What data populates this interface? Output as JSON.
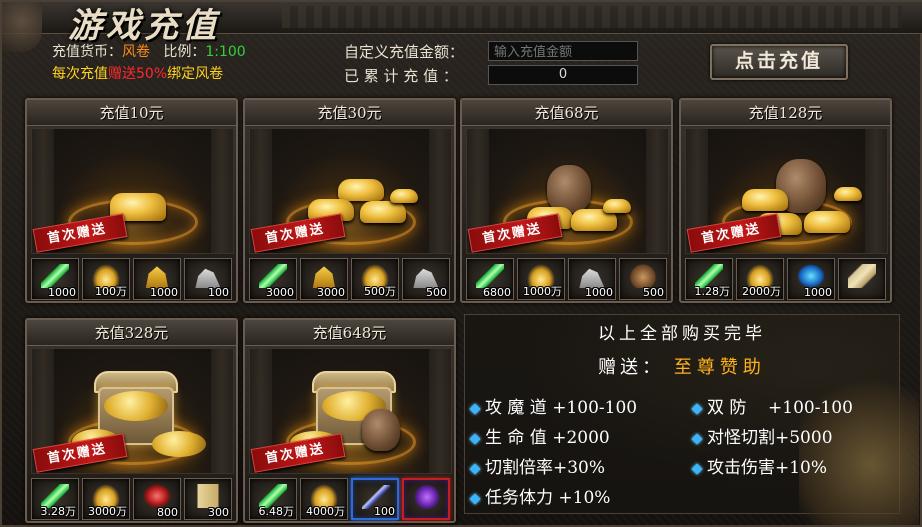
{
  "title": "游戏充值",
  "header": {
    "currency_label": "充值货币：",
    "currency_value": "风卷",
    "ratio_label": "比例：",
    "ratio_value": "1:100",
    "bonus_prefix": "每次充值",
    "bonus_highlight": "赠送50%",
    "bonus_suffix": "绑定风卷",
    "custom_amount_label": "自定义充值金额：",
    "custom_amount_placeholder": "输入充值金额",
    "custom_amount_value": "",
    "total_label": "已 累 计 充 值 ：",
    "total_value": "0",
    "charge_button": "点击充值"
  },
  "packages": [
    {
      "title": "充值10元",
      "ribbon": "首次赠送",
      "items": [
        {
          "icon": "scroll-icon",
          "count": "1000"
        },
        {
          "icon": "gold-ingot-icon",
          "count": "100万"
        },
        {
          "icon": "gold-bars-icon",
          "count": "1000"
        },
        {
          "icon": "silver-ore-icon",
          "count": "100"
        }
      ]
    },
    {
      "title": "充值30元",
      "ribbon": "首次赠送",
      "items": [
        {
          "icon": "scroll-icon",
          "count": "3000"
        },
        {
          "icon": "gold-bars-icon",
          "count": "3000"
        },
        {
          "icon": "gold-ingot-icon",
          "count": "500万"
        },
        {
          "icon": "silver-ore-icon",
          "count": "500"
        }
      ]
    },
    {
      "title": "充值68元",
      "ribbon": "首次赠送",
      "items": [
        {
          "icon": "scroll-icon",
          "count": "6800"
        },
        {
          "icon": "gold-ingot-icon",
          "count": "1000万"
        },
        {
          "icon": "silver-ore-icon",
          "count": "1000"
        },
        {
          "icon": "pouch-icon",
          "count": "500"
        }
      ]
    },
    {
      "title": "充值128元",
      "ribbon": "首次赠送",
      "items": [
        {
          "icon": "scroll-icon",
          "count": "1.28万"
        },
        {
          "icon": "gold-ingot-icon",
          "count": "2000万"
        },
        {
          "icon": "blue-gem-icon",
          "count": "1000"
        },
        {
          "icon": "parchment-icon",
          "count": ""
        }
      ]
    },
    {
      "title": "充值328元",
      "ribbon": "首次赠送",
      "items": [
        {
          "icon": "scroll-icon",
          "count": "3.28万"
        },
        {
          "icon": "gold-ingot-icon",
          "count": "3000万"
        },
        {
          "icon": "ruby-icon",
          "count": "800"
        },
        {
          "icon": "paper-icon",
          "count": "300"
        }
      ]
    },
    {
      "title": "充值648元",
      "ribbon": "首次赠送",
      "items": [
        {
          "icon": "scroll-icon",
          "count": "6.48万"
        },
        {
          "icon": "gold-ingot-icon",
          "count": "4000万"
        },
        {
          "icon": "blade-icon",
          "count": "100",
          "frame": "blue"
        },
        {
          "icon": "purple-orb-icon",
          "count": "",
          "frame": "purple"
        }
      ]
    }
  ],
  "reward": {
    "heading": "以上全部购买完毕",
    "gift_label": "赠送：",
    "gift_name": "至尊赞助",
    "stats": [
      {
        "label": "攻 魔 道",
        "value": "+100-100"
      },
      {
        "label": "双  防",
        "value": "+100-100"
      },
      {
        "label": "生 命 值",
        "value": "+2000"
      },
      {
        "label": "对怪切割",
        "value": "+5000"
      },
      {
        "label": "切割倍率",
        "value": "+30%"
      },
      {
        "label": "攻击伤害",
        "value": "+10%"
      },
      {
        "label": "任务体力",
        "value": "+10%"
      }
    ]
  }
}
